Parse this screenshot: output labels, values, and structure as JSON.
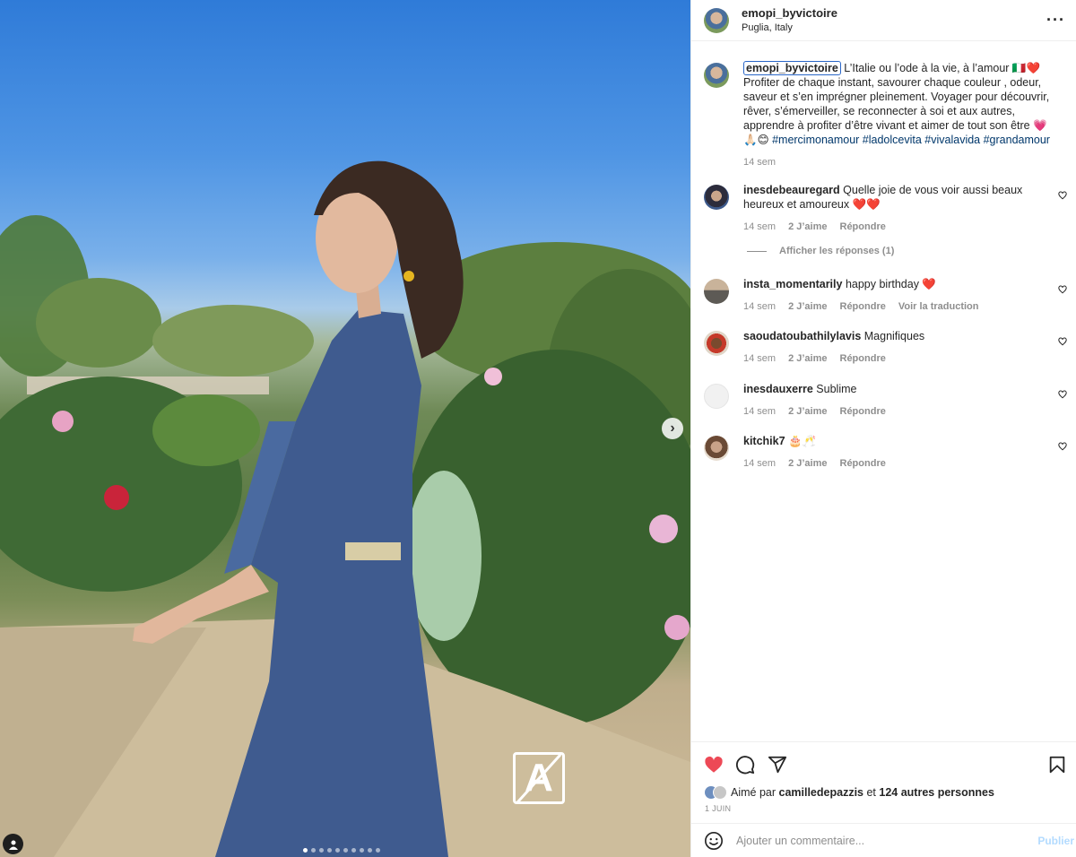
{
  "post": {
    "username": "emopi_byvictoire",
    "location": "Puglia, Italy",
    "more_icon": "more-horizontal-icon",
    "carousel": {
      "total": 10,
      "active": 0
    },
    "watermark_glyph": "A"
  },
  "caption": {
    "username": "emopi_byvictoire",
    "text": " L’Italie ou l’ode à la vie, à l’amour 🇮🇹❤️ Profiter de chaque instant, savourer chaque couleur , odeur, saveur et s’en imprégner pleinement. Voyager pour découvrir, rêver, s’émerveiller, se reconnecter à soi et aux autres, apprendre à profiter d’être vivant et aimer de tout son être 💗🙏🏻😊 ",
    "hashtags": "#mercimonamour #ladolcevita #vivalavida #grandamour",
    "time": "14 sem"
  },
  "comments": [
    {
      "user": "inesdebeauregard",
      "text": " Quelle joie de vous voir aussi beaux heureux et amoureux ❤️❤️",
      "time": "14 sem",
      "likes": "2 J’aime",
      "reply": "Répondre",
      "extra": ""
    },
    {
      "user": "insta_momentarily",
      "text": " happy birthday ❤️",
      "time": "14 sem",
      "likes": "2 J’aime",
      "reply": "Répondre",
      "extra": "Voir la traduction"
    },
    {
      "user": "saoudatoubathilylavis",
      "text": " Magnifiques",
      "time": "14 sem",
      "likes": "2 J’aime",
      "reply": "Répondre",
      "extra": ""
    },
    {
      "user": "inesdauxerre",
      "text": " Sublime",
      "time": "14 sem",
      "likes": "2 J’aime",
      "reply": "Répondre",
      "extra": ""
    },
    {
      "user": "kitchik7",
      "text": " 🎂🥂",
      "time": "14 sem",
      "likes": "2 J’aime",
      "reply": "Répondre",
      "extra": ""
    }
  ],
  "view_replies": "Afficher les réponses (1)",
  "likes": {
    "prefix": "Aimé par ",
    "user": "camilledepazzis",
    "middle": " et ",
    "others": "124 autres personnes"
  },
  "date": "1 JUIN",
  "add_comment": {
    "placeholder": "Ajouter un commentaire...",
    "publish": "Publier"
  },
  "colors": {
    "like_red": "#ed4956",
    "link_blue": "#00376b",
    "caption_outline": "#2a66c7"
  }
}
